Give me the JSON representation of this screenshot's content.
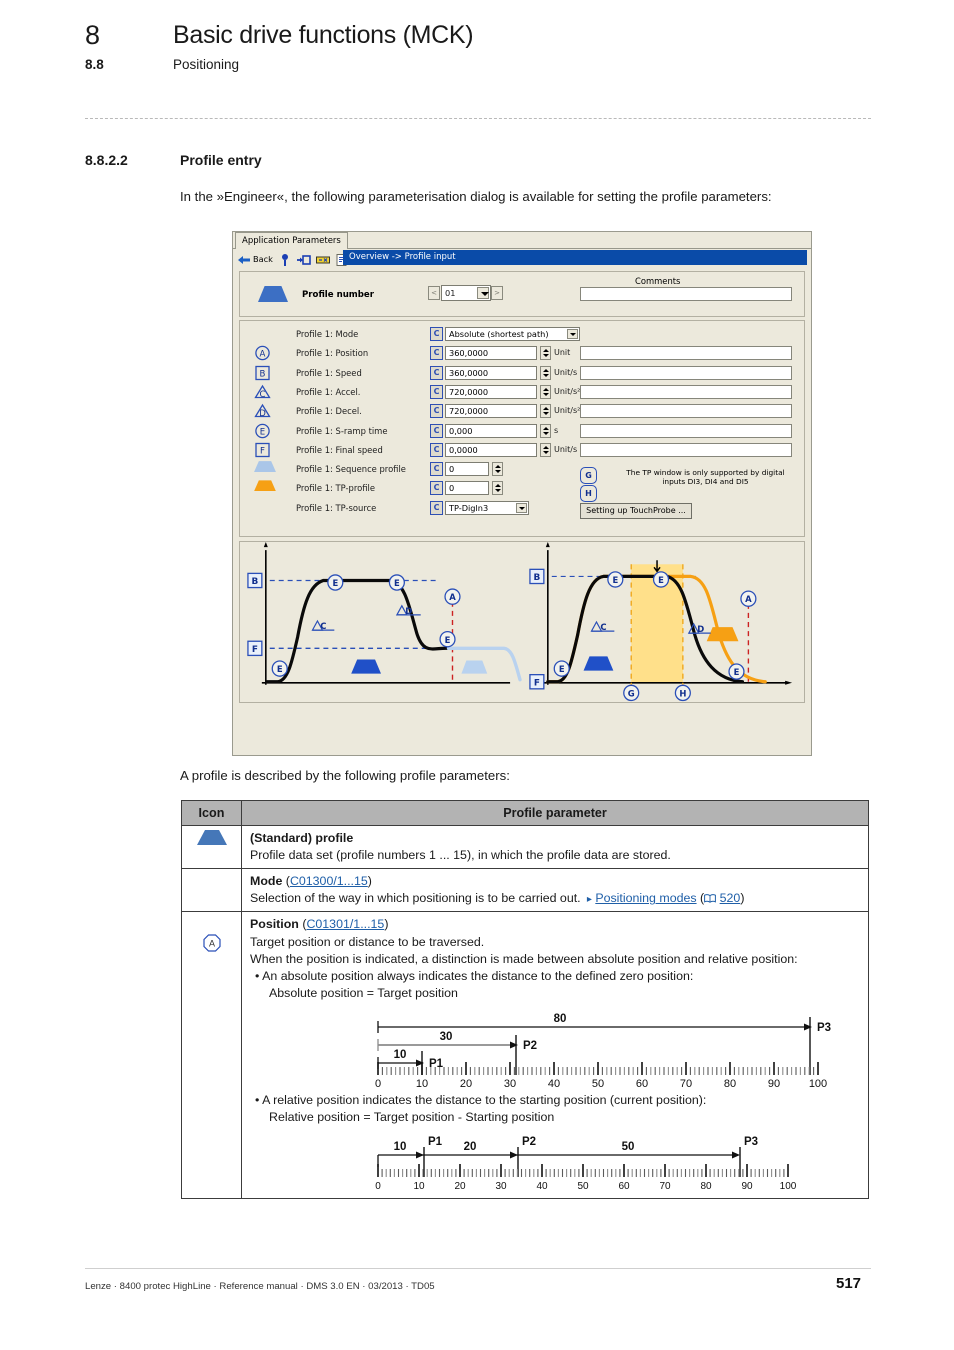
{
  "header": {
    "chapter_number": "8",
    "chapter_title": "Basic drive functions (MCK)",
    "section_number": "8.8",
    "section_title": "Positioning"
  },
  "section": {
    "number": "8.8.2.2",
    "title": "Profile entry",
    "intro": "In the »Engineer«, the following parameterisation dialog is available for setting the profile parameters:"
  },
  "engineer_dialog": {
    "tab_label": "Application Parameters",
    "toolbar": {
      "back_label": "Back",
      "icons": [
        "back-arrow-icon",
        "info-icon",
        "goto-icon",
        "key-icon",
        "properties-icon"
      ]
    },
    "breadcrumb": "Overview -> Profile input",
    "profile_number": {
      "label": "Profile number",
      "icon": "blue-trapezoid-icon",
      "prev_label": "<",
      "next_label": ">",
      "value": "01"
    },
    "comments_label": "Comments",
    "comments_value": "",
    "rows": [
      {
        "icon": "",
        "label": "Profile 1: Mode",
        "cbtn": "C",
        "value": "Absolute (shortest path)",
        "unit": "",
        "kind": "combo"
      },
      {
        "icon": "A",
        "label": "Profile 1: Position",
        "cbtn": "C",
        "value": "360,0000",
        "unit": "Unit",
        "kind": "num"
      },
      {
        "icon": "B",
        "label": "Profile 1: Speed",
        "cbtn": "C",
        "value": "360,0000",
        "unit": "Unit/s",
        "kind": "num"
      },
      {
        "icon": "C",
        "label": "Profile 1: Accel.",
        "cbtn": "C",
        "value": "720,0000",
        "unit": "Unit/s²",
        "kind": "num"
      },
      {
        "icon": "D",
        "label": "Profile 1: Decel.",
        "cbtn": "C",
        "value": "720,0000",
        "unit": "Unit/s²",
        "kind": "num"
      },
      {
        "icon": "E",
        "label": "Profile 1: S-ramp time",
        "cbtn": "C",
        "value": "0,000",
        "unit": "s",
        "kind": "num"
      },
      {
        "icon": "F",
        "label": "Profile 1: Final speed",
        "cbtn": "C",
        "value": "0,0000",
        "unit": "Unit/s",
        "kind": "num"
      },
      {
        "icon": "trapz-light",
        "label": "Profile 1: Sequence profile",
        "cbtn": "C",
        "value": "0",
        "unit": "",
        "kind": "small"
      },
      {
        "icon": "trapz-orange",
        "label": "Profile 1: TP-profile",
        "cbtn": "C",
        "value": "0",
        "unit": "",
        "kind": "small"
      },
      {
        "icon": "",
        "label": "Profile 1: TP-source",
        "cbtn": "C",
        "value": "TP-Digln3",
        "unit": "",
        "kind": "combo2"
      }
    ],
    "tp_note": "The TP window is only supported by digital inputs DI3, DI4 and DI5",
    "tp_note_badges": [
      "G",
      "H"
    ],
    "touchprobe_button": "Setting up TouchProbe ...",
    "graph_labels": {
      "left": [
        "B",
        "F",
        "E",
        "E",
        "C",
        "D",
        "E",
        "A",
        "E"
      ],
      "right": [
        "B",
        "F",
        "E",
        "E",
        "C",
        "D",
        "E",
        "A",
        "G",
        "H"
      ]
    }
  },
  "description_line": "A profile is described by the following profile parameters:",
  "table": {
    "headers": [
      "Icon",
      "Profile parameter"
    ],
    "rows": [
      {
        "icon": "blue-trapezoid-icon",
        "name": "(Standard) profile",
        "code": "",
        "lines": [
          "Profile data set (profile numbers 1 ... 15), in which the profile data are stored."
        ]
      },
      {
        "icon": "",
        "name": "Mode",
        "code": "C01300/1...15",
        "lines": [
          "Selection of the way in which positioning is to be carried out."
        ],
        "reference": {
          "text": "Positioning modes",
          "page": "520"
        }
      },
      {
        "icon": "A",
        "name": "Position",
        "code": "C01301/1...15",
        "lines": [
          "Target position or distance to be traversed.",
          "When the position is indicated, a distinction is made between absolute position and relative position:"
        ],
        "bullet1": "• An absolute position always indicates the distance to the defined zero position:",
        "bullet1_sub": "Absolute position = Target position",
        "bullet2": "• A relative position indicates the distance to the starting position (current position):",
        "bullet2_sub": "Relative position = Target position - Starting position"
      }
    ]
  },
  "chart_data": [
    {
      "type": "line",
      "name": "profile-graph-left",
      "title": "",
      "annotations": [
        "B",
        "F",
        "A",
        "C",
        "D",
        "E"
      ],
      "series": [
        {
          "name": "standard profile",
          "color": "#000000"
        },
        {
          "name": "sequence profile",
          "color": "#aac6e8"
        }
      ]
    },
    {
      "type": "line",
      "name": "profile-graph-right",
      "title": "",
      "annotations": [
        "B",
        "F",
        "A",
        "C",
        "D",
        "E",
        "G",
        "H"
      ],
      "series": [
        {
          "name": "standard profile",
          "color": "#000000"
        },
        {
          "name": "TP profile",
          "color": "#f6a014"
        }
      ],
      "tp_window": {
        "start_label": "G",
        "end_label": "H",
        "fill": "#ffe08a"
      }
    },
    {
      "type": "scale",
      "name": "absolute-position-scale",
      "axis_min": 0,
      "axis_max": 100,
      "tick_labels": [
        0,
        10,
        20,
        30,
        40,
        50,
        60,
        70,
        80,
        90,
        100
      ],
      "markers": [
        {
          "label": "P1",
          "position": 10,
          "distance": "10",
          "from": 0
        },
        {
          "label": "P2",
          "position": 30,
          "distance": "30",
          "from": 0
        },
        {
          "label": "P3",
          "position": 80,
          "distance": "80",
          "from": 0
        }
      ]
    },
    {
      "type": "scale",
      "name": "relative-position-scale",
      "axis_min": 0,
      "axis_max": 100,
      "tick_labels": [
        0,
        10,
        20,
        30,
        40,
        50,
        60,
        70,
        80,
        90,
        100
      ],
      "markers": [
        {
          "label": "P1",
          "position": 10,
          "distance": "10",
          "from": 0
        },
        {
          "label": "P2",
          "position": 30,
          "distance": "20",
          "from": 10
        },
        {
          "label": "P3",
          "position": 80,
          "distance": "50",
          "from": 30
        }
      ]
    }
  ],
  "footer": {
    "text": "Lenze · 8400 protec HighLine · Reference manual · DMS 3.0 EN · 03/2013 · TD05",
    "page": "517"
  }
}
